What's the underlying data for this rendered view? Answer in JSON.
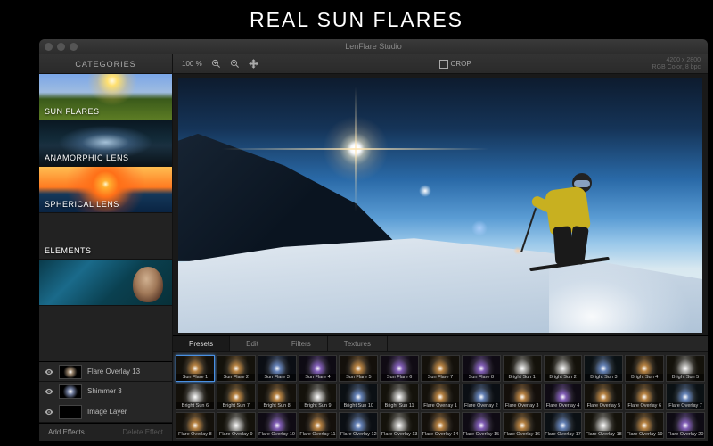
{
  "heading": "REAL SUN FLARES",
  "titlebar": {
    "title": "LenFlare Studio"
  },
  "toolbar": {
    "categories_label": "CATEGORIES",
    "zoom_value": "100 %",
    "crop_label": "CROP",
    "info_dim": "4200 x 2800",
    "info_mode": "RGB Color, 8 bpc"
  },
  "categories": [
    {
      "label": "SUN FLARES",
      "selected": true
    },
    {
      "label": "ANAMORPHIC LENS",
      "selected": false
    },
    {
      "label": "SPHERICAL LENS",
      "selected": false
    },
    {
      "label": "ELEMENTS",
      "selected": false
    },
    {
      "label": "",
      "selected": false
    }
  ],
  "layers": [
    {
      "label": "Flare Overlay 13",
      "kind": "flare"
    },
    {
      "label": "Shimmer 3",
      "kind": "flare2"
    },
    {
      "label": "Image Layer",
      "kind": "image"
    }
  ],
  "layer_buttons": {
    "add": "Add Effects",
    "delete": "Delete Effect"
  },
  "tabs": [
    {
      "label": "Presets",
      "active": true
    },
    {
      "label": "Edit",
      "active": false
    },
    {
      "label": "Filters",
      "active": false
    },
    {
      "label": "Textures",
      "active": false
    }
  ],
  "presets": [
    {
      "label": "Sun Flare 1",
      "selected": true,
      "hue": 40,
      "style": "warm"
    },
    {
      "label": "Sun Flare 2",
      "selected": false,
      "hue": 45,
      "style": "warm"
    },
    {
      "label": "Sun Flare 3",
      "selected": false,
      "hue": 220,
      "style": "cool"
    },
    {
      "label": "Sun Flare 4",
      "selected": false,
      "hue": 260,
      "style": "purple"
    },
    {
      "label": "Sun Flare 5",
      "selected": false,
      "hue": 35,
      "style": "warm"
    },
    {
      "label": "Sun Flare 6",
      "selected": false,
      "hue": 275,
      "style": "purple"
    },
    {
      "label": "Sun Flare 7",
      "selected": false,
      "hue": 42,
      "style": "warm"
    },
    {
      "label": "Sun Flare 8",
      "selected": false,
      "hue": 270,
      "style": "purple"
    },
    {
      "label": "Bright Sun 1",
      "selected": false,
      "hue": 48,
      "style": "white"
    },
    {
      "label": "Bright Sun 2",
      "selected": false,
      "hue": 50,
      "style": "white"
    },
    {
      "label": "Bright Sun 3",
      "selected": false,
      "hue": 200,
      "style": "cool"
    },
    {
      "label": "Bright Sun 4",
      "selected": false,
      "hue": 44,
      "style": "warm"
    },
    {
      "label": "Bright Sun 5",
      "selected": false,
      "hue": 46,
      "style": "white"
    },
    {
      "label": "Bright Sun 6",
      "selected": false,
      "hue": 44,
      "style": "white"
    },
    {
      "label": "Bright Sun 7",
      "selected": false,
      "hue": 50,
      "style": "warm"
    },
    {
      "label": "Bright Sun 8",
      "selected": false,
      "hue": 40,
      "style": "warm"
    },
    {
      "label": "Bright Sun 9",
      "selected": false,
      "hue": 48,
      "style": "white"
    },
    {
      "label": "Bright Sun 10",
      "selected": false,
      "hue": 205,
      "style": "cool"
    },
    {
      "label": "Bright Sun 11",
      "selected": false,
      "hue": 46,
      "style": "white"
    },
    {
      "label": "Flare Overlay 1",
      "selected": false,
      "hue": 38,
      "style": "warm"
    },
    {
      "label": "Flare Overlay 2",
      "selected": false,
      "hue": 210,
      "style": "cool"
    },
    {
      "label": "Flare Overlay 3",
      "selected": false,
      "hue": 30,
      "style": "warm"
    },
    {
      "label": "Flare Overlay 4",
      "selected": false,
      "hue": 265,
      "style": "purple"
    },
    {
      "label": "Flare Overlay 5",
      "selected": false,
      "hue": 42,
      "style": "warm"
    },
    {
      "label": "Flare Overlay 6",
      "selected": false,
      "hue": 44,
      "style": "warm"
    },
    {
      "label": "Flare Overlay 7",
      "selected": false,
      "hue": 200,
      "style": "cool"
    },
    {
      "label": "Flare Overlay 8",
      "selected": false,
      "hue": 40,
      "style": "warm"
    },
    {
      "label": "Flare Overlay 9",
      "selected": false,
      "hue": 48,
      "style": "white"
    },
    {
      "label": "Flare Overlay 10",
      "selected": false,
      "hue": 268,
      "style": "purple"
    },
    {
      "label": "Flare Overlay 11",
      "selected": false,
      "hue": 35,
      "style": "warm"
    },
    {
      "label": "Flare Overlay 12",
      "selected": false,
      "hue": 215,
      "style": "cool"
    },
    {
      "label": "Flare Overlay 13",
      "selected": false,
      "hue": 46,
      "style": "white"
    },
    {
      "label": "Flare Overlay 14",
      "selected": false,
      "hue": 32,
      "style": "warm"
    },
    {
      "label": "Flare Overlay 15",
      "selected": false,
      "hue": 270,
      "style": "purple"
    },
    {
      "label": "Flare Overlay 16",
      "selected": false,
      "hue": 44,
      "style": "warm"
    },
    {
      "label": "Flare Overlay 17",
      "selected": false,
      "hue": 205,
      "style": "cool"
    },
    {
      "label": "Flare Overlay 18",
      "selected": false,
      "hue": 48,
      "style": "white"
    },
    {
      "label": "Flare Overlay 19",
      "selected": false,
      "hue": 40,
      "style": "warm"
    },
    {
      "label": "Flare Overlay 20",
      "selected": false,
      "hue": 260,
      "style": "purple"
    }
  ]
}
